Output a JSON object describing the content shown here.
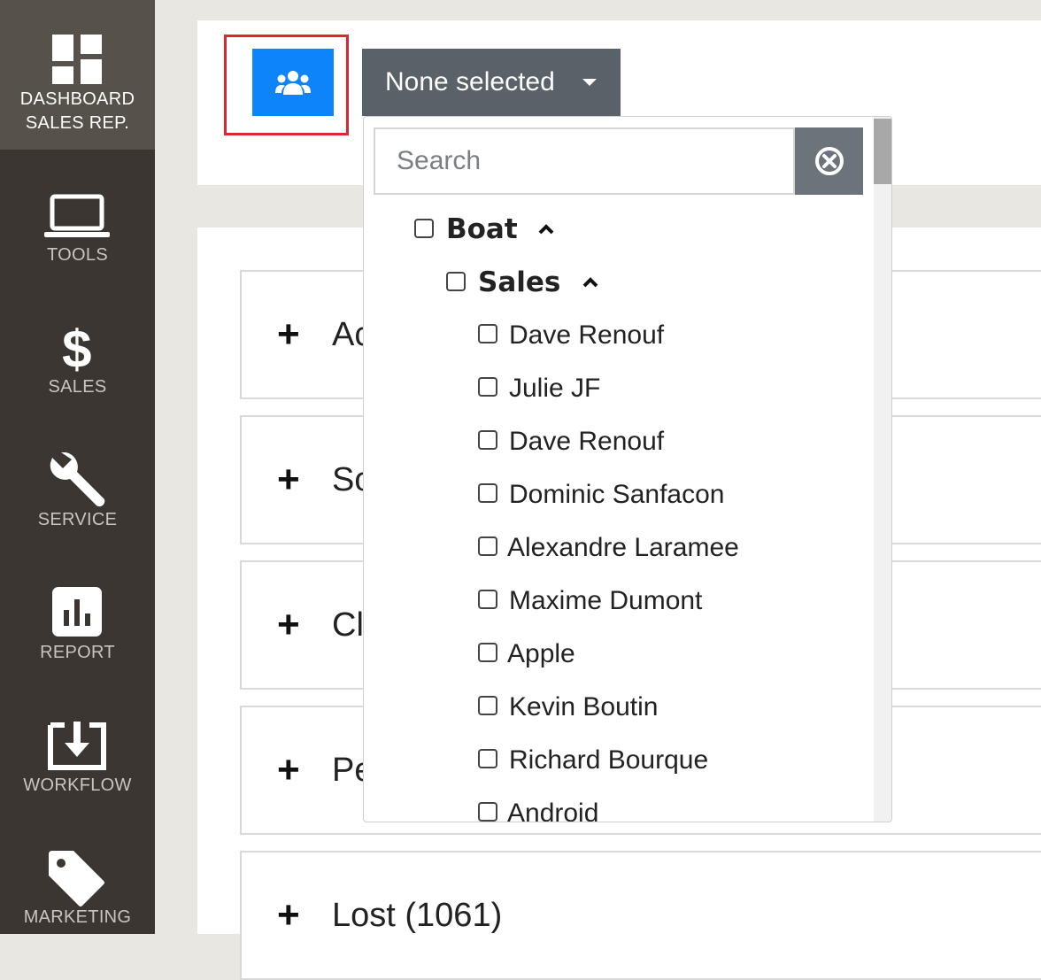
{
  "sidebar": {
    "items": [
      {
        "label_line1": "DASHBOARD",
        "label_line2": "SALES REP.",
        "icon": "dashboard-icon",
        "active": true
      },
      {
        "label": "TOOLS",
        "icon": "laptop-icon"
      },
      {
        "label": "SALES",
        "icon": "dollar-icon"
      },
      {
        "label": "SERVICE",
        "icon": "wrench-icon"
      },
      {
        "label": "REPORT",
        "icon": "bar-chart-icon"
      },
      {
        "label": "WORKFLOW",
        "icon": "download-box-icon"
      },
      {
        "label": "MARKETING",
        "icon": "tag-icon"
      }
    ]
  },
  "toolbar": {
    "group_button_icon": "users-group-icon",
    "select_label": "None selected"
  },
  "dropdown": {
    "search_placeholder": "Search",
    "search_value": "",
    "clear_icon": "clear-circle-icon",
    "groups": [
      {
        "label": "Boat",
        "expanded": true
      },
      {
        "label": "Sales",
        "expanded": true
      }
    ],
    "options": [
      "Dave Renouf",
      "Julie JF",
      "Dave Renouf",
      "Dominic Sanfacon",
      "Alexandre Laramee",
      "Maxime Dumont",
      "Apple",
      "Kevin Boutin",
      "Richard Bourque",
      "Android"
    ]
  },
  "accordion": {
    "items": [
      {
        "title": "Ac"
      },
      {
        "title": "So"
      },
      {
        "title": "Cl"
      },
      {
        "title": "Pe"
      },
      {
        "title": "Lost (1061)"
      }
    ]
  },
  "colors": {
    "sidebar_bg": "#3b3632",
    "sidebar_active": "#57514b",
    "primary_button": "#0d84f9",
    "select_button": "#5a6168",
    "highlight": "#e0262d"
  }
}
